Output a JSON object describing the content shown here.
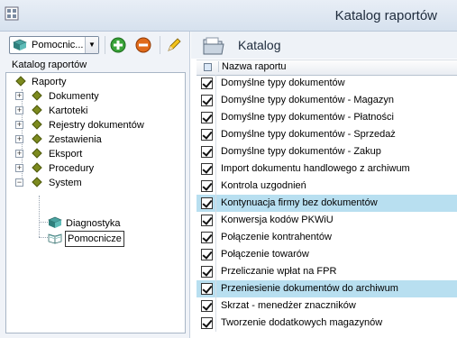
{
  "window": {
    "title": "Katalog raportów"
  },
  "toolbar": {
    "combo_value": "Pomocnic..."
  },
  "left_panel": {
    "title": "Katalog raportów"
  },
  "tree": {
    "root": "Raporty",
    "items": [
      {
        "label": "Dokumenty"
      },
      {
        "label": "Kartoteki"
      },
      {
        "label": "Rejestry dokumentów"
      },
      {
        "label": "Zestawienia"
      },
      {
        "label": "Eksport"
      },
      {
        "label": "Procedury"
      },
      {
        "label": "System"
      }
    ],
    "system_children": [
      {
        "label": "Diagnostyka"
      },
      {
        "label": "Pomocnicze"
      }
    ]
  },
  "right_panel": {
    "title": "Katalog",
    "column_header": "Nazwa raportu"
  },
  "reports": [
    {
      "name": "Domyślne typy dokumentów",
      "checked": true,
      "highlight": false
    },
    {
      "name": "Domyślne typy dokumentów - Magazyn",
      "checked": true,
      "highlight": false
    },
    {
      "name": "Domyślne typy dokumentów - Płatności",
      "checked": true,
      "highlight": false
    },
    {
      "name": "Domyślne typy dokumentów - Sprzedaż",
      "checked": true,
      "highlight": false
    },
    {
      "name": "Domyślne typy dokumentów - Zakup",
      "checked": true,
      "highlight": false
    },
    {
      "name": "Import dokumentu handlowego z archiwum",
      "checked": true,
      "highlight": false
    },
    {
      "name": "Kontrola uzgodnień",
      "checked": true,
      "highlight": false
    },
    {
      "name": "Kontynuacja firmy bez dokumentów",
      "checked": true,
      "highlight": true
    },
    {
      "name": "Konwersja kodów PKWiU",
      "checked": true,
      "highlight": false
    },
    {
      "name": "Połączenie kontrahentów",
      "checked": true,
      "highlight": false
    },
    {
      "name": "Połączenie towarów",
      "checked": true,
      "highlight": false
    },
    {
      "name": "Przeliczanie wpłat na FPR",
      "checked": true,
      "highlight": false
    },
    {
      "name": "Przeniesienie dokumentów do archiwum",
      "checked": true,
      "highlight": true
    },
    {
      "name": "Skrzat - menedżer znaczników",
      "checked": true,
      "highlight": false
    },
    {
      "name": "Tworzenie dodatkowych magazynów",
      "checked": true,
      "highlight": false
    }
  ],
  "colors": {
    "highlight": "#b8dff0",
    "tree_icon": "#7c8a1e"
  }
}
